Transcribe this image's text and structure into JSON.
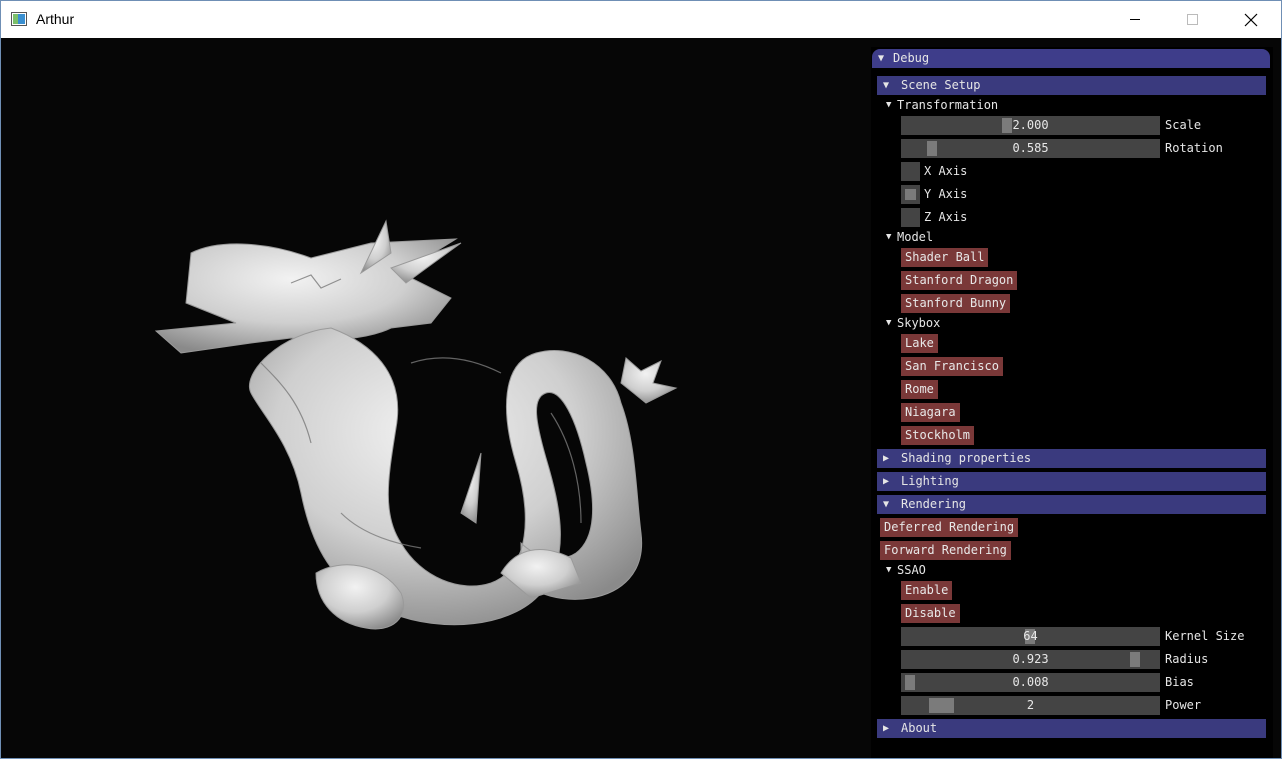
{
  "window": {
    "title": "Arthur"
  },
  "panel": {
    "title": "Debug",
    "scene_setup": {
      "label": "Scene Setup",
      "transformation": {
        "label": "Transformation",
        "scale": {
          "value": "2.000",
          "label": "Scale",
          "fraction": 0.4
        },
        "rotation": {
          "value": "0.585",
          "label": "Rotation",
          "fraction": 0.1
        },
        "x_axis": {
          "label": "X Axis",
          "checked": false
        },
        "y_axis": {
          "label": "Y Axis",
          "checked": true
        },
        "z_axis": {
          "label": "Z Axis",
          "checked": false
        }
      },
      "model": {
        "label": "Model",
        "buttons": [
          "Shader Ball",
          "Stanford Dragon",
          "Stanford Bunny"
        ]
      },
      "skybox": {
        "label": "Skybox",
        "buttons": [
          "Lake",
          "San Francisco",
          "Rome",
          "Niagara",
          "Stockholm"
        ]
      }
    },
    "shading_properties": {
      "label": "Shading properties"
    },
    "lighting": {
      "label": "Lighting"
    },
    "rendering": {
      "label": "Rendering",
      "deferred": "Deferred Rendering",
      "forward": "Forward Rendering",
      "ssao": {
        "label": "SSAO",
        "enable": "Enable",
        "disable": "Disable",
        "kernel_size": {
          "value": "64",
          "label": "Kernel Size",
          "fraction": 0.5
        },
        "radius": {
          "value": "0.923",
          "label": "Radius",
          "fraction": 0.92
        },
        "bias": {
          "value": "0.008",
          "label": "Bias",
          "fraction": 0.01
        },
        "power": {
          "value": "2",
          "label": "Power",
          "fraction": 0.14
        }
      }
    },
    "about": {
      "label": "About"
    }
  },
  "colors": {
    "panel_header": "#3a3a7e",
    "button": "#7a3838",
    "slider_frame": "#444444",
    "slider_grab": "#7b7b7b",
    "viewport_bg": "#060606"
  }
}
